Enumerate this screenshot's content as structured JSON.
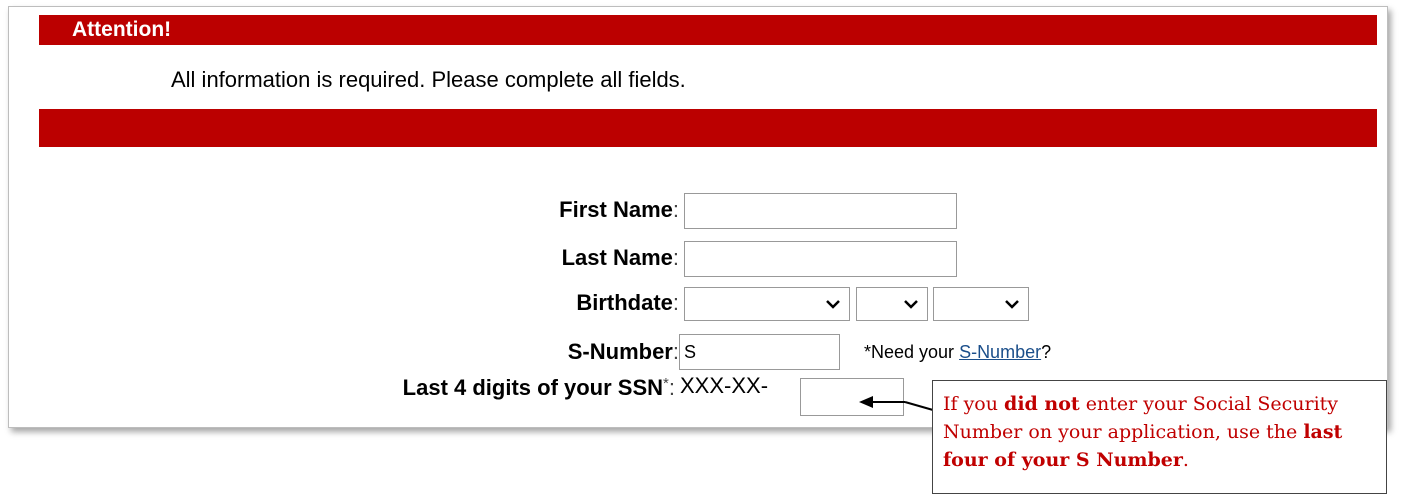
{
  "banner": {
    "title": "Attention!"
  },
  "notice": "All information is required. Please complete all fields.",
  "form": {
    "first_name": {
      "label": "First Name",
      "colon": ":",
      "value": ""
    },
    "last_name": {
      "label": "Last Name",
      "colon": ":",
      "value": ""
    },
    "birthdate": {
      "label": "Birthdate",
      "colon": ":",
      "month": "",
      "day": "",
      "year": ""
    },
    "s_number": {
      "label": "S-Number",
      "colon": ":",
      "value": "S",
      "help_prefix": "*Need your ",
      "help_link": "S-Number",
      "help_suffix": "?"
    },
    "ssn": {
      "label": "Last 4 digits of your SSN",
      "asterisk": "*",
      "colon": ":",
      "prefix": "XXX-XX-",
      "value": ""
    }
  },
  "callout": {
    "part1": "If you ",
    "bold1": "did not",
    "part2": " enter your Social Security Number on your application, use the ",
    "bold2": "last four of your S Number",
    "part3": "."
  },
  "colors": {
    "banner": "#bb0000",
    "callout_text": "#c00000",
    "link": "#1a4e8a"
  },
  "icons": [
    "chevron-down-icon",
    "arrow-left-icon"
  ]
}
